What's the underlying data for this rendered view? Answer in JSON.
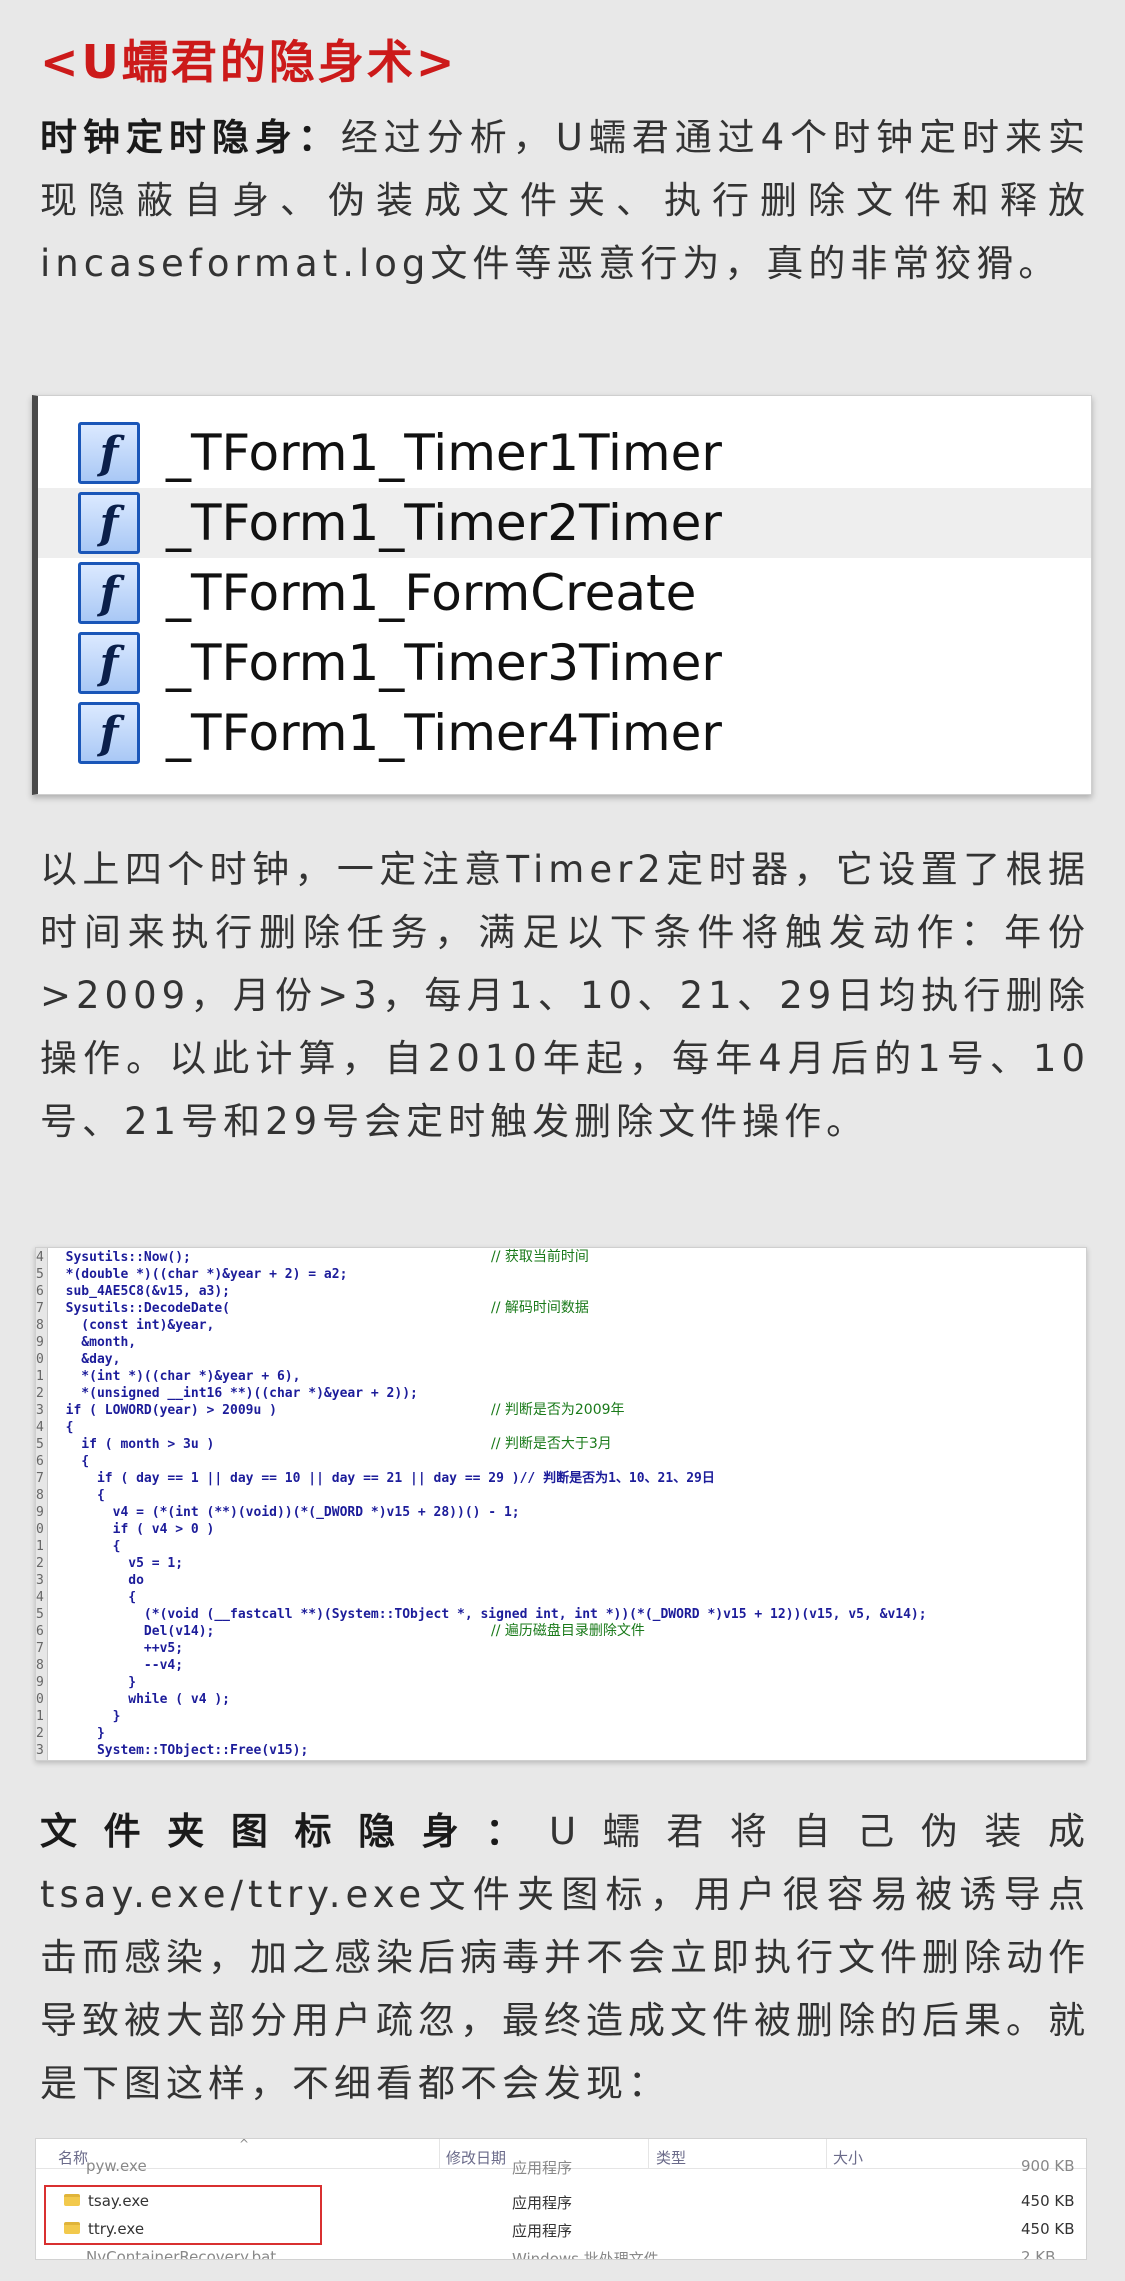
{
  "section_title": "<U蠕君的隐身术>",
  "para1": {
    "lead": "时钟定时隐身：",
    "text": "经过分析，U蠕君通过4个时钟定时来实现隐蔽自身、伪装成文件夹、执行删除文件和释放incaseformat.log文件等恶意行为，真的非常狡猾。"
  },
  "function_list": {
    "icon": "function-f-icon",
    "icon_glyph": "f",
    "items": [
      "_TForm1_Timer1Timer",
      "_TForm1_Timer2Timer",
      "_TForm1_FormCreate",
      "_TForm1_Timer3Timer",
      "_TForm1_Timer4Timer"
    ]
  },
  "para2": "以上四个时钟，一定注意Timer2定时器，它设置了根据时间来执行删除任务，满足以下条件将触发动作：年份>2009，月份>3，每月1、10、21、29日均执行删除操作。以此计算，自2010年起，每年4月后的1号、10号、21号和29号会定时触发删除文件操作。",
  "code": {
    "lines": [
      {
        "n": "4",
        "code": "  Sysutils::Now();",
        "comment": "// 获取当前时间"
      },
      {
        "n": "5",
        "code": "  *(double *)((char *)&year + 2) = a2;",
        "comment": ""
      },
      {
        "n": "6",
        "code": "  sub_4AE5C8(&v15, a3);",
        "comment": ""
      },
      {
        "n": "7",
        "code": "  Sysutils::DecodeDate(",
        "comment": "// 解码时间数据"
      },
      {
        "n": "8",
        "code": "    (const int)&year,",
        "comment": ""
      },
      {
        "n": "9",
        "code": "    &month,",
        "comment": ""
      },
      {
        "n": "0",
        "code": "    &day,",
        "comment": ""
      },
      {
        "n": "1",
        "code": "    *(int *)((char *)&year + 6),",
        "comment": ""
      },
      {
        "n": "2",
        "code": "    *(unsigned __int16 **)((char *)&year + 2));",
        "comment": ""
      },
      {
        "n": "3",
        "code": "  if ( LOWORD(year) > 2009u )",
        "comment": "// 判断是否为2009年"
      },
      {
        "n": "4",
        "code": "  {",
        "comment": ""
      },
      {
        "n": "5",
        "code": "    if ( month > 3u )",
        "comment": "// 判断是否大于3月"
      },
      {
        "n": "6",
        "code": "    {",
        "comment": ""
      },
      {
        "n": "7",
        "code": "      if ( day == 1 || day == 10 || day == 21 || day == 29 )// 判断是否为1、10、21、29日",
        "comment": ""
      },
      {
        "n": "8",
        "code": "      {",
        "comment": ""
      },
      {
        "n": "9",
        "code": "        v4 = (*(int (**)(void))(*(_DWORD *)v15 + 28))() - 1;",
        "comment": ""
      },
      {
        "n": "0",
        "code": "        if ( v4 > 0 )",
        "comment": ""
      },
      {
        "n": "1",
        "code": "        {",
        "comment": ""
      },
      {
        "n": "2",
        "code": "          v5 = 1;",
        "comment": ""
      },
      {
        "n": "3",
        "code": "          do",
        "comment": ""
      },
      {
        "n": "4",
        "code": "          {",
        "comment": ""
      },
      {
        "n": "5",
        "code": "            (*(void (__fastcall **)(System::TObject *, signed int, int *))(*(_DWORD *)v15 + 12))(v15, v5, &v14);",
        "comment": ""
      },
      {
        "n": "6",
        "code": "            Del(v14);",
        "comment": "// 遍历磁盘目录删除文件"
      },
      {
        "n": "7",
        "code": "            ++v5;",
        "comment": ""
      },
      {
        "n": "8",
        "code": "            --v4;",
        "comment": ""
      },
      {
        "n": "9",
        "code": "          }",
        "comment": ""
      },
      {
        "n": "0",
        "code": "          while ( v4 );",
        "comment": ""
      },
      {
        "n": "1",
        "code": "        }",
        "comment": ""
      },
      {
        "n": "2",
        "code": "      }",
        "comment": ""
      },
      {
        "n": "3",
        "code": "      System::TObject::Free(v15);",
        "comment": ""
      }
    ]
  },
  "para3": {
    "lead": "文件夹图标隐身：",
    "text": "U蠕君将自己伪装成tsay.exe/ttry.exe文件夹图标，用户很容易被诱导点击而感染，加之感染后病毒并不会立即执行文件删除动作导致被大部分用户疏忽，最终造成文件被删除的后果。就是下图这样，不细看都不会发现："
  },
  "explorer": {
    "headers": {
      "name": "名称",
      "date": "修改日期",
      "type": "类型",
      "size": "大小"
    },
    "partial_top": {
      "name": "pyw.exe",
      "type": "应用程序",
      "size": "900 KB"
    },
    "rows": [
      {
        "name": "tsay.exe",
        "type": "应用程序",
        "size": "450 KB"
      },
      {
        "name": "ttry.exe",
        "type": "应用程序",
        "size": "450 KB"
      }
    ],
    "partial_bottom": {
      "name": "NvContainerRecovery.bat",
      "type": "Windows 批处理文件",
      "size": "2 KB"
    }
  },
  "colors": {
    "title_red": "#cc1a1a",
    "highlight_frame": "#d93030",
    "code_blue": "#1c1c9a",
    "comment_green": "#1a7a1a"
  }
}
